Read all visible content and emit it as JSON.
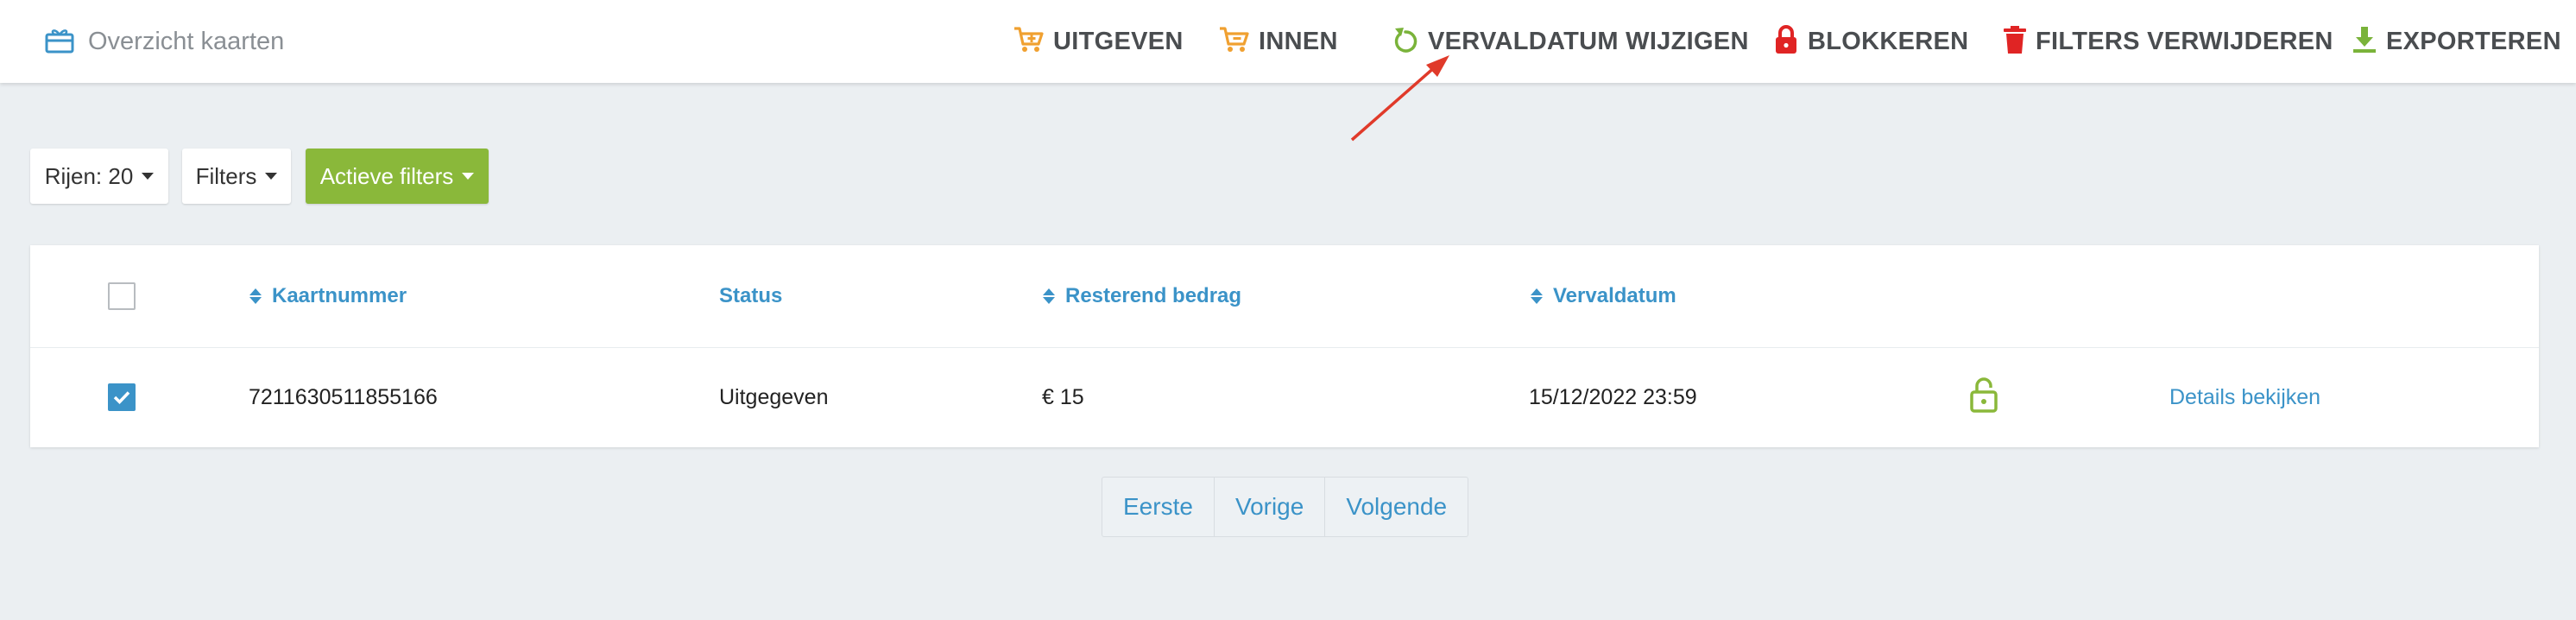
{
  "header": {
    "title": "Overzicht kaarten",
    "title_icon": "gift-card-icon",
    "actions": [
      {
        "label": "UITGEVEN",
        "icon": "cart-plus-icon",
        "color": "#f0a030"
      },
      {
        "label": "INNEN",
        "icon": "cart-minus-icon",
        "color": "#f0a030"
      },
      {
        "label": "VERVALDATUM WIJZIGEN",
        "icon": "refresh-icon",
        "color": "#7ab33a"
      },
      {
        "label": "BLOKKEREN",
        "icon": "lock-icon",
        "color": "#e02424"
      },
      {
        "label": "FILTERS VERWIJDEREN",
        "icon": "trash-icon",
        "color": "#e02424"
      },
      {
        "label": "EXPORTEREN",
        "icon": "download-icon",
        "color": "#7ab33a"
      }
    ]
  },
  "toolbar": {
    "rows_label": "Rijen: 20",
    "filters_label": "Filters",
    "active_filters_label": "Actieve filters"
  },
  "table": {
    "columns": [
      "Kaartnummer",
      "Status",
      "Resterend bedrag",
      "Vervaldatum"
    ],
    "header_checked": false,
    "rows": [
      {
        "checked": true,
        "card_number": "7211630511855166",
        "status": "Uitgegeven",
        "remaining": "€ 15",
        "expiry": "15/12/2022 23:59",
        "lock_icon": "unlock-icon",
        "details_label": "Details bekijken"
      }
    ]
  },
  "pagination": {
    "first": "Eerste",
    "previous": "Vorige",
    "next": "Volgende"
  },
  "colors": {
    "accent_blue": "#3b93c8",
    "green": "#8ab83a",
    "annotation_red": "#e03a2a"
  }
}
